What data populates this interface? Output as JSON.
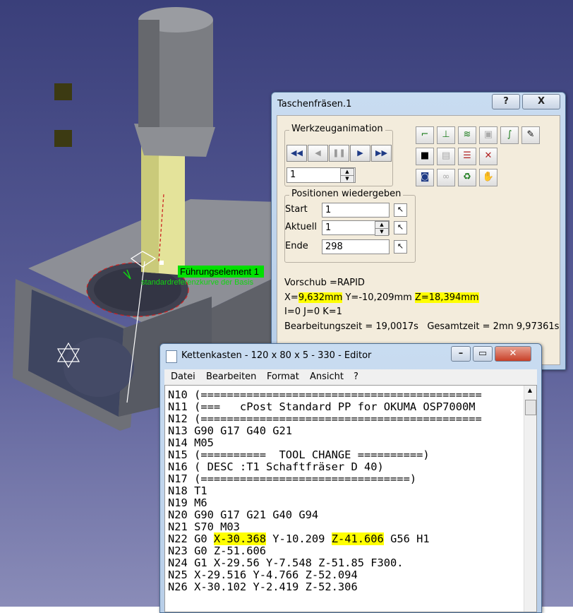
{
  "scene": {
    "annotation_element": "Führungselement 1",
    "annotation_circle": "standardreferenzkurve der Basis"
  },
  "dialog": {
    "title": "Taschenfräsen.1",
    "help_label": "?",
    "close_label": "X",
    "animation_group": {
      "legend": "Werkzeuganimation",
      "step_value": "1"
    },
    "positions_group": {
      "legend": "Positionen wiedergeben",
      "start_label": "Start",
      "start_value": "1",
      "current_label": "Aktuell",
      "current_value": "1",
      "end_label": "Ende",
      "end_value": "298"
    },
    "info": {
      "feed": "Vorschub =RAPID",
      "x_label": "X=",
      "x_value": "9,632mm",
      "y_text": " Y=-10,209mm ",
      "z_label": "Z=18,394mm",
      "ijk": "I=0 J=0 K=1",
      "machining_time": "Bearbeitungszeit = 19,0017s",
      "total_time": "Gesamtzeit = 2mn 9,97361s"
    }
  },
  "notepad": {
    "title": "Kettenkasten - 120 x 80 x 5 - 330 - Editor",
    "menu": [
      "Datei",
      "Bearbeiten",
      "Format",
      "Ansicht",
      "?"
    ],
    "lines": [
      "N10 (===========================================",
      "N11 (===   cPost Standard PP for OKUMA OSP7000M",
      "N12 (===========================================",
      "N13 G90 G17 G40 G21",
      "N14 M05",
      "N15 (==========  TOOL CHANGE ==========)",
      "N16 ( DESC :T1 Schaftfräser D 40)",
      "N17 (================================)",
      "N18 T1",
      "N19 M6",
      "N20 G90 G17 G21 G40 G94",
      "N21 S70 M03"
    ],
    "line22": {
      "prefix": "N22 G0 ",
      "x": "X-30.368",
      "mid": " Y-10.209 ",
      "z": "Z-41.606",
      "suffix": " G56 H1"
    },
    "lines_after": [
      "N23 G0 Z-51.606",
      "N24 G1 X-29.56 Y-7.548 Z-51.85 F300.",
      "N25 X-29.516 Y-4.766 Z-52.094",
      "N26 X-30.102 Y-2.419 Z-52.306"
    ]
  }
}
